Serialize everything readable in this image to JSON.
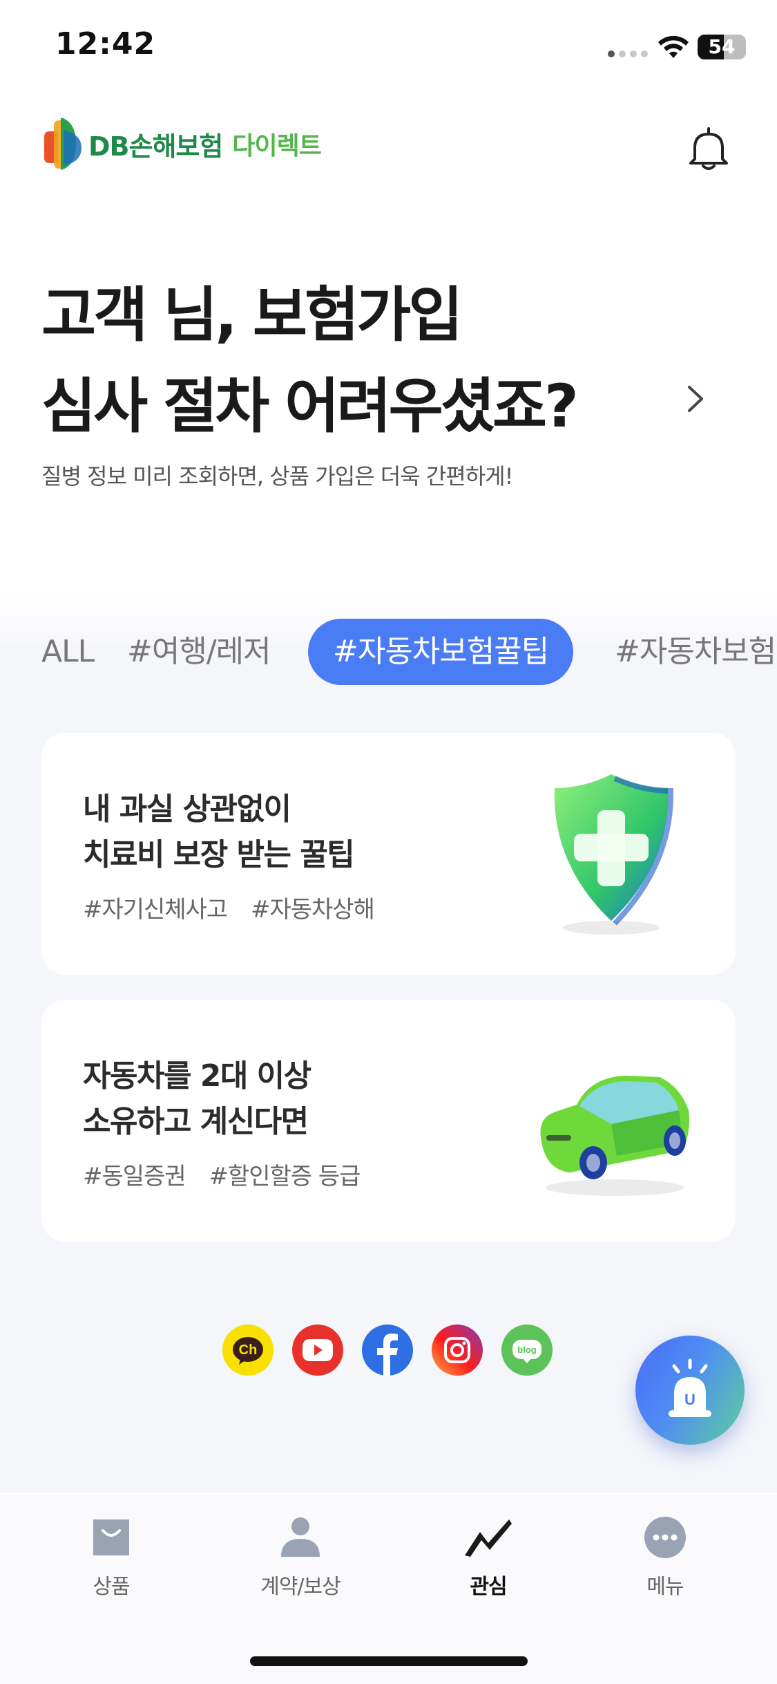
{
  "status_bar": {
    "time": "12:42",
    "battery": "54"
  },
  "header": {
    "logo_main": "DB손해보험",
    "logo_sub": "다이렉트"
  },
  "hero": {
    "title_line1": "고객 님, 보험가입",
    "title_line2": "심사 절차 어려우셨죠?",
    "subtitle": "질병 정보 미리 조회하면, 상품 가입은 더욱 간편하게!"
  },
  "tags": [
    {
      "label": "ALL",
      "active": false
    },
    {
      "label": "#여행/레저",
      "active": false
    },
    {
      "label": "#자동차보험꿀팁",
      "active": true
    },
    {
      "label": "#자동차보험",
      "active": false
    }
  ],
  "cards": [
    {
      "title_line1": "내 과실 상관없이",
      "title_line2": "치료비 보장 받는 꿀팁",
      "hashtags": [
        "#자기신체사고",
        "#자동차상해"
      ],
      "illustration": "shield-cross-icon"
    },
    {
      "title_line1": "자동차를 2대 이상",
      "title_line2": "소유하고 계신다면",
      "hashtags": [
        "#동일증권",
        "#할인할증 등급"
      ],
      "illustration": "car-icon"
    }
  ],
  "social": [
    {
      "name": "kakao-channel-icon",
      "glyph": "Ch",
      "color": "#f9e000"
    },
    {
      "name": "youtube-icon",
      "color": "#e8312a"
    },
    {
      "name": "facebook-icon",
      "glyph": "f",
      "color": "#2f6fe3"
    },
    {
      "name": "instagram-icon",
      "color": "#d6249f"
    },
    {
      "name": "blog-icon",
      "glyph": "blog",
      "color": "#5ec25a"
    }
  ],
  "fab": {
    "label": "U"
  },
  "tabbar": [
    {
      "label": "상품",
      "icon": "shopping-bag-icon",
      "active": false
    },
    {
      "label": "계약/보상",
      "icon": "person-icon",
      "active": false
    },
    {
      "label": "관심",
      "icon": "zigzag-icon",
      "active": true
    },
    {
      "label": "메뉴",
      "icon": "more-dots-icon",
      "active": false
    }
  ],
  "colors": {
    "accent": "#4a7cf6",
    "brand_green": "#1e8a4a"
  }
}
